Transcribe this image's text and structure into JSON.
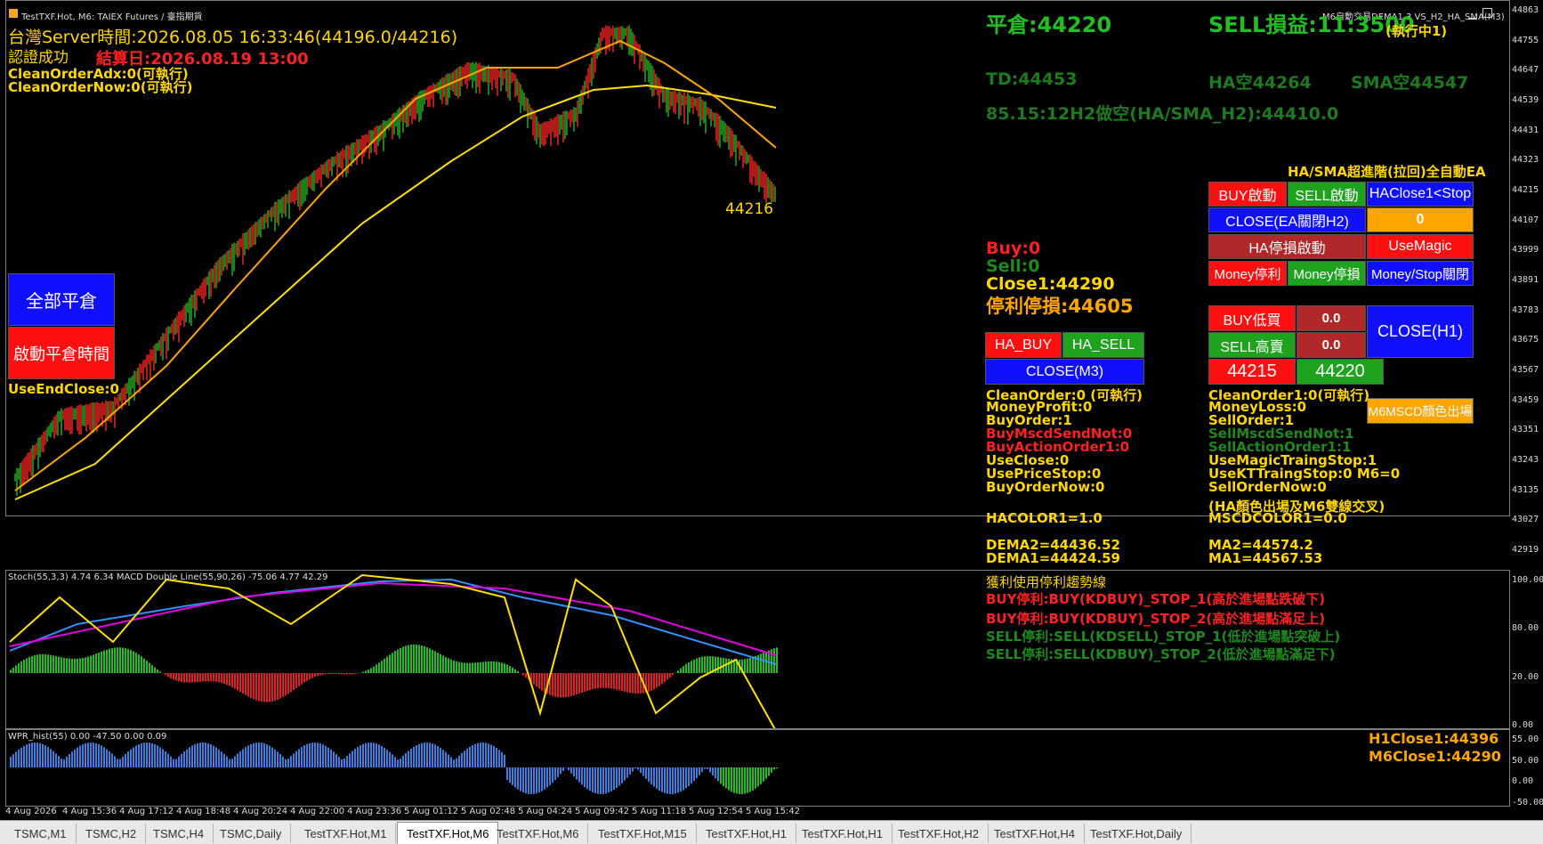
{
  "window": {
    "title": "TestTXF.Hot, M6:  TAIEX Futures / 臺指期貨",
    "right_title": "M6自動交易DEMA1.3 VS_H2_HA_SMA(M3)"
  },
  "left_info": {
    "server_time": "台灣Server時間:2026.08.05 16:33:46(44196.0/44216)",
    "auth": "認證成功",
    "settle": "結算日:2026.08.19 13:00",
    "clean_adx": "CleanOrderAdx:0(可執行)",
    "clean_now": "CleanOrderNow:0(可執行)",
    "use_end_close": "UseEndClose:0"
  },
  "buttons": {
    "close_all": "全部平倉",
    "start_close_time": "啟動平倉時間",
    "ha_buy": "HA_BUY",
    "ha_sell": "HA_SELL",
    "close_m3": "CLOSE(M3)",
    "buy_start": "BUY啟動",
    "sell_start": "SELL啟動",
    "haclose_stop": "HAClose1<Stop",
    "close_ea": "CLOSE(EA關閉H2)",
    "ea_value": "0",
    "ha_stop_start": "HA停損啟動",
    "use_magic": "UseMagic",
    "money_profit": "Money停利",
    "money_stop": "Money停損",
    "money_stop_close": "Money/Stop關閉",
    "buy_low": "BUY低買",
    "buy_low_val": "0.0",
    "sell_high": "SELL高賣",
    "sell_high_val": "0.0",
    "close_h1": "CLOSE(H1)",
    "price_bid": "44215",
    "price_ask": "44220",
    "msc_color": "M6MSCD顏色出場"
  },
  "right_info": {
    "flat": "平倉:44220",
    "sell_pl": "SELL損益:11:3500",
    "executing": "(執行中1)",
    "td": "TD:44453",
    "ha_short": "HA空44264",
    "sma_short": "SMA空44547",
    "h2_line": "85.15:12H2做空(HA/SMA_H2):44410.0",
    "ea_title": "HA/SMA超進階(拉回)全自動EA",
    "buy_count": "Buy:0",
    "sell_count": "Sell:0",
    "close1": "Close1:44290",
    "stop_profit": "停利停損:44605",
    "price_label": "44216"
  },
  "left_col": [
    {
      "t": "CleanOrder:0 (可執行)",
      "c": "#ffd700"
    },
    {
      "t": "MoneyProfit:0",
      "c": "#ffd700"
    },
    {
      "t": "BuyOrder:1",
      "c": "#ffd700"
    },
    {
      "t": "BuyMscdSendNot:0",
      "c": "#ff2020"
    },
    {
      "t": "BuyActionOrder1:0",
      "c": "#ff2020"
    },
    {
      "t": "UseClose:0",
      "c": "#ffd700"
    },
    {
      "t": "UsePriceStop:0",
      "c": "#ffd700"
    },
    {
      "t": "BuyOrderNow:0",
      "c": "#ffd700"
    }
  ],
  "right_col": [
    {
      "t": "CleanOrder1:0(可執行)",
      "c": "#ffd700"
    },
    {
      "t": "MoneyLoss:0",
      "c": "#ffd700"
    },
    {
      "t": "SellOrder:1",
      "c": "#ffd700"
    },
    {
      "t": "SellMscdSendNot:1",
      "c": "#1e8a1e"
    },
    {
      "t": "SellActionOrder1:1",
      "c": "#1e8a1e"
    },
    {
      "t": "UseMagicTraingStop:1",
      "c": "#ffd700"
    },
    {
      "t": "UseKTTraingStop:0  M6=0",
      "c": "#ffd700"
    },
    {
      "t": "SellOrderNow:0",
      "c": "#ffd700"
    }
  ],
  "bottom_values": {
    "ha_note": "(HA顏色出場及M6雙線交叉)",
    "hacolor": "HACOLOR1=1.0",
    "mscdcolor": "MSCDCOLOR1=0.0",
    "dema2": "DEMA2=44436.52",
    "dema1": "DEMA1=44424.59",
    "ma2": "MA2=44574.2",
    "ma1": "MA1=44567.53"
  },
  "stop_lines": {
    "title": "獲利使用停利趨勢線",
    "l1": "BUY停利:BUY(KDBUY)_STOP_1(高於進場點跌破下)",
    "l2": "BUY停利:BUY(KDBUY)_STOP_2(高於進場點滿足上)",
    "l3": "SELL停利:SELL(KDSELL)_STOP_1(低於進場點突破上)",
    "l4": "SELL停利:SELL(KDBUY)_STOP_2(低於進場點滿足下)"
  },
  "h1_close": "H1Close1:44396",
  "m6_close": "M6Close1:44290",
  "indicator_labels": {
    "stoch": "Stoch(55,3,3) 4.74 6.34 MACD Double Line(55,90,26) -75.06 4.77 42.29",
    "wpr": "WPR_hist(55) 0.00 -47.50 0.00 0.09"
  },
  "price_axis": [
    "44863",
    "44755",
    "44647",
    "44539",
    "44431",
    "44323",
    "44215",
    "44107",
    "43999",
    "43891",
    "43783",
    "43675",
    "43567",
    "43459",
    "43351",
    "43243",
    "43135",
    "43027",
    "42919"
  ],
  "stoch_axis": [
    "100.00",
    "80.00",
    "20.00",
    "0.00"
  ],
  "wpr_axis": [
    "55.00",
    "50.00",
    "0.00",
    "-50.00"
  ],
  "time_axis": [
    "4 Aug 2026",
    "4 Aug 15:36",
    "4 Aug 17:12",
    "4 Aug 18:48",
    "4 Aug 20:24",
    "4 Aug 22:00",
    "4 Aug 23:36",
    "5 Aug 01:12",
    "5 Aug 02:48",
    "5 Aug 04:24",
    "5 Aug 09:42",
    "5 Aug 11:18",
    "5 Aug 12:54",
    "5 Aug 15:42"
  ],
  "tabs": [
    "TSMC,M1",
    "TSMC,H2",
    "TSMC,H4",
    "TSMC,Daily",
    "TestTXF.Hot,M1",
    "TestTXF.Hot,M6",
    "TestTXF.Hot,M6",
    "TestTXF.Hot,M15",
    "TestTXF.Hot,H1",
    "TestTXF.Hot,H1",
    "TestTXF.Hot,H2",
    "TestTXF.Hot,H4",
    "TestTXF.Hot,Daily"
  ],
  "active_tab": 5
}
